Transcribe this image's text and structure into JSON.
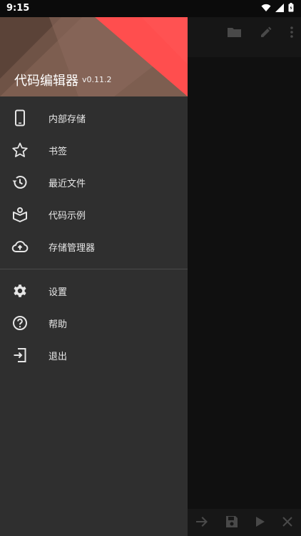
{
  "status_bar": {
    "time": "9:15"
  },
  "drawer": {
    "title": "代码编辑器",
    "version": "v0.11.2",
    "items_primary": [
      {
        "label": "内部存储",
        "icon": "phone-icon"
      },
      {
        "label": "书签",
        "icon": "star-icon"
      },
      {
        "label": "最近文件",
        "icon": "history-icon"
      },
      {
        "label": "代码示例",
        "icon": "book-icon"
      },
      {
        "label": "存储管理器",
        "icon": "cloud-upload-icon"
      }
    ],
    "items_secondary": [
      {
        "label": "设置",
        "icon": "gear-icon"
      },
      {
        "label": "帮助",
        "icon": "help-icon"
      },
      {
        "label": "退出",
        "icon": "exit-icon"
      }
    ]
  },
  "colors": {
    "drawer_bg": "#2f2f2f",
    "header_brown": "#7a5a4c",
    "header_red": "#ff5252",
    "icon": "#e6e6e6"
  }
}
